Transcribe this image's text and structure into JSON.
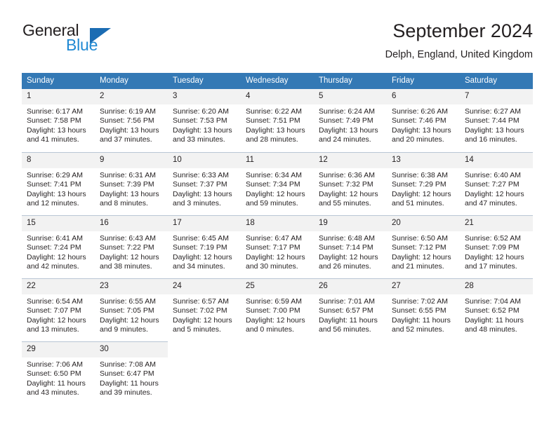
{
  "brand": {
    "name_part1": "General",
    "name_part2": "Blue",
    "triangle_color": "#1b6cb3",
    "blue_text_color": "#2089d3"
  },
  "header": {
    "title": "September 2024",
    "subtitle": "Delph, England, United Kingdom"
  },
  "theme": {
    "header_row_background": "#3479b5",
    "header_row_text": "#ffffff",
    "daynum_background": "#f2f2f2",
    "grid_line": "#b9c6d4",
    "body_text": "#231f20"
  },
  "labels": {
    "sunrise_prefix": "Sunrise:",
    "sunset_prefix": "Sunset:",
    "daylight_prefix": "Daylight:"
  },
  "weekday_headers": [
    "Sunday",
    "Monday",
    "Tuesday",
    "Wednesday",
    "Thursday",
    "Friday",
    "Saturday"
  ],
  "weeks": [
    [
      {
        "day": "1",
        "sunrise": "Sunrise: 6:17 AM",
        "sunset": "Sunset: 7:58 PM",
        "daylight_line1": "Daylight: 13 hours",
        "daylight_line2": "and 41 minutes."
      },
      {
        "day": "2",
        "sunrise": "Sunrise: 6:19 AM",
        "sunset": "Sunset: 7:56 PM",
        "daylight_line1": "Daylight: 13 hours",
        "daylight_line2": "and 37 minutes."
      },
      {
        "day": "3",
        "sunrise": "Sunrise: 6:20 AM",
        "sunset": "Sunset: 7:53 PM",
        "daylight_line1": "Daylight: 13 hours",
        "daylight_line2": "and 33 minutes."
      },
      {
        "day": "4",
        "sunrise": "Sunrise: 6:22 AM",
        "sunset": "Sunset: 7:51 PM",
        "daylight_line1": "Daylight: 13 hours",
        "daylight_line2": "and 28 minutes."
      },
      {
        "day": "5",
        "sunrise": "Sunrise: 6:24 AM",
        "sunset": "Sunset: 7:49 PM",
        "daylight_line1": "Daylight: 13 hours",
        "daylight_line2": "and 24 minutes."
      },
      {
        "day": "6",
        "sunrise": "Sunrise: 6:26 AM",
        "sunset": "Sunset: 7:46 PM",
        "daylight_line1": "Daylight: 13 hours",
        "daylight_line2": "and 20 minutes."
      },
      {
        "day": "7",
        "sunrise": "Sunrise: 6:27 AM",
        "sunset": "Sunset: 7:44 PM",
        "daylight_line1": "Daylight: 13 hours",
        "daylight_line2": "and 16 minutes."
      }
    ],
    [
      {
        "day": "8",
        "sunrise": "Sunrise: 6:29 AM",
        "sunset": "Sunset: 7:41 PM",
        "daylight_line1": "Daylight: 13 hours",
        "daylight_line2": "and 12 minutes."
      },
      {
        "day": "9",
        "sunrise": "Sunrise: 6:31 AM",
        "sunset": "Sunset: 7:39 PM",
        "daylight_line1": "Daylight: 13 hours",
        "daylight_line2": "and 8 minutes."
      },
      {
        "day": "10",
        "sunrise": "Sunrise: 6:33 AM",
        "sunset": "Sunset: 7:37 PM",
        "daylight_line1": "Daylight: 13 hours",
        "daylight_line2": "and 3 minutes."
      },
      {
        "day": "11",
        "sunrise": "Sunrise: 6:34 AM",
        "sunset": "Sunset: 7:34 PM",
        "daylight_line1": "Daylight: 12 hours",
        "daylight_line2": "and 59 minutes."
      },
      {
        "day": "12",
        "sunrise": "Sunrise: 6:36 AM",
        "sunset": "Sunset: 7:32 PM",
        "daylight_line1": "Daylight: 12 hours",
        "daylight_line2": "and 55 minutes."
      },
      {
        "day": "13",
        "sunrise": "Sunrise: 6:38 AM",
        "sunset": "Sunset: 7:29 PM",
        "daylight_line1": "Daylight: 12 hours",
        "daylight_line2": "and 51 minutes."
      },
      {
        "day": "14",
        "sunrise": "Sunrise: 6:40 AM",
        "sunset": "Sunset: 7:27 PM",
        "daylight_line1": "Daylight: 12 hours",
        "daylight_line2": "and 47 minutes."
      }
    ],
    [
      {
        "day": "15",
        "sunrise": "Sunrise: 6:41 AM",
        "sunset": "Sunset: 7:24 PM",
        "daylight_line1": "Daylight: 12 hours",
        "daylight_line2": "and 42 minutes."
      },
      {
        "day": "16",
        "sunrise": "Sunrise: 6:43 AM",
        "sunset": "Sunset: 7:22 PM",
        "daylight_line1": "Daylight: 12 hours",
        "daylight_line2": "and 38 minutes."
      },
      {
        "day": "17",
        "sunrise": "Sunrise: 6:45 AM",
        "sunset": "Sunset: 7:19 PM",
        "daylight_line1": "Daylight: 12 hours",
        "daylight_line2": "and 34 minutes."
      },
      {
        "day": "18",
        "sunrise": "Sunrise: 6:47 AM",
        "sunset": "Sunset: 7:17 PM",
        "daylight_line1": "Daylight: 12 hours",
        "daylight_line2": "and 30 minutes."
      },
      {
        "day": "19",
        "sunrise": "Sunrise: 6:48 AM",
        "sunset": "Sunset: 7:14 PM",
        "daylight_line1": "Daylight: 12 hours",
        "daylight_line2": "and 26 minutes."
      },
      {
        "day": "20",
        "sunrise": "Sunrise: 6:50 AM",
        "sunset": "Sunset: 7:12 PM",
        "daylight_line1": "Daylight: 12 hours",
        "daylight_line2": "and 21 minutes."
      },
      {
        "day": "21",
        "sunrise": "Sunrise: 6:52 AM",
        "sunset": "Sunset: 7:09 PM",
        "daylight_line1": "Daylight: 12 hours",
        "daylight_line2": "and 17 minutes."
      }
    ],
    [
      {
        "day": "22",
        "sunrise": "Sunrise: 6:54 AM",
        "sunset": "Sunset: 7:07 PM",
        "daylight_line1": "Daylight: 12 hours",
        "daylight_line2": "and 13 minutes."
      },
      {
        "day": "23",
        "sunrise": "Sunrise: 6:55 AM",
        "sunset": "Sunset: 7:05 PM",
        "daylight_line1": "Daylight: 12 hours",
        "daylight_line2": "and 9 minutes."
      },
      {
        "day": "24",
        "sunrise": "Sunrise: 6:57 AM",
        "sunset": "Sunset: 7:02 PM",
        "daylight_line1": "Daylight: 12 hours",
        "daylight_line2": "and 5 minutes."
      },
      {
        "day": "25",
        "sunrise": "Sunrise: 6:59 AM",
        "sunset": "Sunset: 7:00 PM",
        "daylight_line1": "Daylight: 12 hours",
        "daylight_line2": "and 0 minutes."
      },
      {
        "day": "26",
        "sunrise": "Sunrise: 7:01 AM",
        "sunset": "Sunset: 6:57 PM",
        "daylight_line1": "Daylight: 11 hours",
        "daylight_line2": "and 56 minutes."
      },
      {
        "day": "27",
        "sunrise": "Sunrise: 7:02 AM",
        "sunset": "Sunset: 6:55 PM",
        "daylight_line1": "Daylight: 11 hours",
        "daylight_line2": "and 52 minutes."
      },
      {
        "day": "28",
        "sunrise": "Sunrise: 7:04 AM",
        "sunset": "Sunset: 6:52 PM",
        "daylight_line1": "Daylight: 11 hours",
        "daylight_line2": "and 48 minutes."
      }
    ],
    [
      {
        "day": "29",
        "sunrise": "Sunrise: 7:06 AM",
        "sunset": "Sunset: 6:50 PM",
        "daylight_line1": "Daylight: 11 hours",
        "daylight_line2": "and 43 minutes."
      },
      {
        "day": "30",
        "sunrise": "Sunrise: 7:08 AM",
        "sunset": "Sunset: 6:47 PM",
        "daylight_line1": "Daylight: 11 hours",
        "daylight_line2": "and 39 minutes."
      },
      null,
      null,
      null,
      null,
      null
    ]
  ]
}
